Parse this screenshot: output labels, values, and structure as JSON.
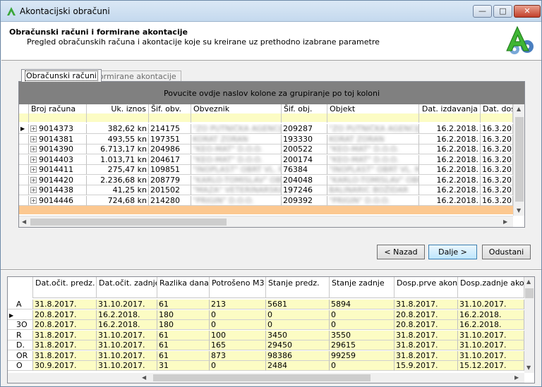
{
  "window": {
    "title": "Akontacijski obračuni",
    "minimize": "—",
    "maximize": "□",
    "close": "✕"
  },
  "header": {
    "title": "Obračunski računi i formirane akontacije",
    "subtitle": "Pregled obračunskih računa i akontacije koje su kreirane uz prethodno izabrane parametre"
  },
  "tabs": [
    {
      "label": "Obračunski računi",
      "active": true
    },
    {
      "label": "Formirane akontacije",
      "active": false
    }
  ],
  "grid1": {
    "group_hint": "Povucite ovdje naslov kolone za grupiranje po toj koloni",
    "columns": [
      "Broj računa",
      "Uk. iznos",
      "Šif. obv.",
      "Obveznik",
      "Šif. obj.",
      "Objekt",
      "Dat. izdavanja",
      "Dat. dosp"
    ],
    "rows": [
      {
        "broj": "9014373",
        "iznos": "382,62 kn",
        "sif_obv": "214175",
        "obveznik": "\"ZO PUTNIČKA AGENCIJ\"",
        "sif_obj": "209287",
        "objekt": "\"ZO PUTNIČKA AGENCIJ",
        "dat_izd": "16.2.2018.",
        "dat_dosp": "16.3.20"
      },
      {
        "broj": "9014381",
        "iznos": "493,55 kn",
        "sif_obv": "197351",
        "obveznik": "KORAT ZORAN",
        "sif_obj": "193330",
        "objekt": "KORAT ZORAN",
        "dat_izd": "16.2.2018.",
        "dat_dosp": "16.3.20"
      },
      {
        "broj": "9014390",
        "iznos": "6.713,17 kn",
        "sif_obv": "204986",
        "obveznik": "\"KEO-MAT\" D.O.O.",
        "sif_obj": "200522",
        "objekt": "\"KEO-MAT\" D.O.O.",
        "dat_izd": "16.2.2018.",
        "dat_dosp": "16.3.20"
      },
      {
        "broj": "9014403",
        "iznos": "1.013,71 kn",
        "sif_obv": "204617",
        "obveznik": "\"KEO-MAT\" D.O.O.",
        "sif_obj": "200174",
        "objekt": "\"KEO-MAT\" D.O.O.",
        "dat_izd": "16.2.2018.",
        "dat_dosp": "16.3.20"
      },
      {
        "broj": "9014411",
        "iznos": "275,47 kn",
        "sif_obv": "109851",
        "obveznik": "\"INOPLAST\" OBRT VL. M",
        "sif_obj": "76384",
        "objekt": "\"INOPLAST\" OBRT VL. MAJ",
        "dat_izd": "16.2.2018.",
        "dat_dosp": "16.3.20"
      },
      {
        "broj": "9014420",
        "iznos": "2.236,68 kn",
        "sif_obv": "208779",
        "obveznik": "\"KARLO-TOMISLAV\" OBR",
        "sif_obj": "204048",
        "objekt": "\"KARLO-TOMISLAV\" OBR",
        "dat_izd": "16.2.2018.",
        "dat_dosp": "16.3.20"
      },
      {
        "broj": "9014438",
        "iznos": "41,25 kn",
        "sif_obv": "201502",
        "obveznik": "\"MAZA\" VETERINARSKA",
        "sif_obj": "197246",
        "objekt": "BALINARIC BOŽIDAR",
        "dat_izd": "16.2.2018.",
        "dat_dosp": "16.3.20"
      },
      {
        "broj": "9014446",
        "iznos": "724,68 kn",
        "sif_obv": "214280",
        "obveznik": "\"PRIGIN\" D.O.O.",
        "sif_obj": "209392",
        "objekt": "\"PRIGIN\" D.O.O.",
        "dat_izd": "16.2.2018.",
        "dat_dosp": "16.3.20"
      }
    ]
  },
  "buttons": {
    "back": "< Nazad",
    "next": "Dalje >",
    "cancel": "Odustani"
  },
  "grid2": {
    "columns": [
      "Dat.očit. predz.",
      "Dat.očit. zadnje",
      "Razlika dana",
      "Potrošeno M3",
      "Stanje predz.",
      "Stanje zadnje",
      "Dosp.prve akont.",
      "Dosp.zadnje akont."
    ],
    "row_prefixes": [
      "A",
      "",
      "3O",
      "R",
      "D.",
      "OR",
      "O"
    ],
    "rows": [
      [
        "31.8.2017.",
        "31.10.2017.",
        "61",
        "213",
        "5681",
        "5894",
        "31.8.2017.",
        "31.10.2017."
      ],
      [
        "20.8.2017.",
        "16.2.2018.",
        "180",
        "0",
        "0",
        "0",
        "20.8.2017.",
        "16.2.2018."
      ],
      [
        "20.8.2017.",
        "16.2.2018.",
        "180",
        "0",
        "0",
        "0",
        "20.8.2017.",
        "16.2.2018."
      ],
      [
        "31.8.2017.",
        "31.10.2017.",
        "61",
        "100",
        "3450",
        "3550",
        "31.8.2017.",
        "31.10.2017."
      ],
      [
        "31.8.2017.",
        "31.10.2017.",
        "61",
        "165",
        "29450",
        "29615",
        "31.8.2017.",
        "31.10.2017."
      ],
      [
        "31.8.2017.",
        "31.10.2017.",
        "61",
        "873",
        "98386",
        "99259",
        "31.8.2017.",
        "31.10.2017."
      ],
      [
        "30.9.2017.",
        "31.10.2017.",
        "31",
        "0",
        "2484",
        "0",
        "15.9.2017.",
        "15.12.2017."
      ]
    ]
  }
}
